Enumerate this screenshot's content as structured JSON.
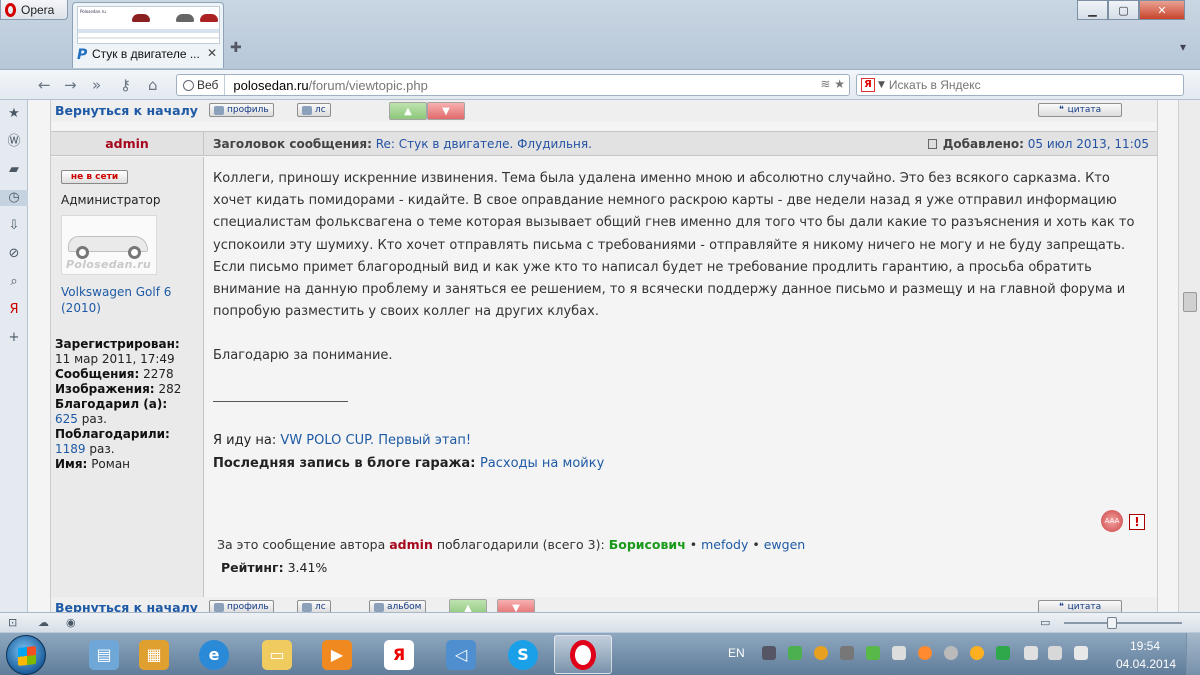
{
  "browser": {
    "menu_label": "Opera",
    "tab": {
      "title": "Стук в двигателе ...",
      "thumb_caption": "Polosedan.ru"
    },
    "address": {
      "mode": "Веб",
      "host": "polosedan.ru",
      "path": "/forum/viewtopic.php"
    },
    "search": {
      "engine_badge": "Я",
      "placeholder": "Искать в Яндекс"
    },
    "zoom_fraction": 0.4
  },
  "forum": {
    "back_link": "Вернуться к началу",
    "buttons": {
      "profile": "профиль",
      "pm": "лс",
      "album": "альбом",
      "quote": "цитата"
    },
    "post": {
      "author": "admin",
      "subject_label": "Заголовок сообщения:",
      "subject": "Re: Стук в двигателе. Флудильня.",
      "date_label": "Добавлено:",
      "date": "05 июл 2013, 11:05",
      "status": "не в сети",
      "rank": "Администратор",
      "avatar_watermark": "Polosedan.ru",
      "car": "Volkswagen Golf 6 (2010)",
      "stats": {
        "registered_label": "Зарегистрирован:",
        "registered": "11 мар 2011, 17:49",
        "posts_label": "Сообщения:",
        "posts": "2278",
        "images_label": "Изображения:",
        "images": "282",
        "thanked_label": "Благодарил (а):",
        "thanked": "625",
        "thanked_unit": "раз.",
        "thanked_by_label": "Поблагодарили:",
        "thanked_by": "1189",
        "thanked_by_unit": "раз.",
        "name_label": "Имя:",
        "name": "Роман"
      },
      "body": "Коллеги, приношу искренние извинения. Тема была удалена именно мною и абсолютно случайно. Это без всякого сарказма. Кто хочет кидать помидорами - кидайте. В свое оправдание немного раскрою карты - две недели назад я уже отправил информацию специалистам фольксвагена о теме которая вызывает общий гнев именно для того что бы дали какие то разъяснения и хоть как то успокоили эту шумиху. Кто хочет отправлять письма с требованиями - отправляйте я никому ничего не могу и не буду запрещать. Если письмо примет благородный вид и как уже кто то написал будет не требование продлить гарантию, а просьба обратить внимание на данную проблему и заняться ее решением, то я всячески поддержу данное письмо и размещу и на главной форума и попробую разместить у своих коллег на других клубах.",
      "body2": "Благодарю за понимание.",
      "sig_going_label": "Я иду на:",
      "sig_going_link": "VW POLO CUP. Первый этап!",
      "sig_blog_label": "Последняя запись в блоге гаража:",
      "sig_blog_link": "Расходы на мойку",
      "report_badge": "!",
      "thanks_prefix": "За это сообщение автора",
      "thanks_author": "admin",
      "thanks_middle": "поблагодарили (всего 3):",
      "thanks_users": [
        "Борисович",
        "mefody",
        "ewgen"
      ],
      "thanks_sep": "•",
      "rating_label": "Рейтинг:",
      "rating_value": "3.41%"
    }
  },
  "taskbar": {
    "lang": "EN",
    "time": "19:54",
    "date": "04.04.2014",
    "apps": [
      "explorer",
      "network",
      "internet-explorer",
      "folder",
      "media",
      "yandex",
      "speaker",
      "skype",
      "opera"
    ]
  }
}
